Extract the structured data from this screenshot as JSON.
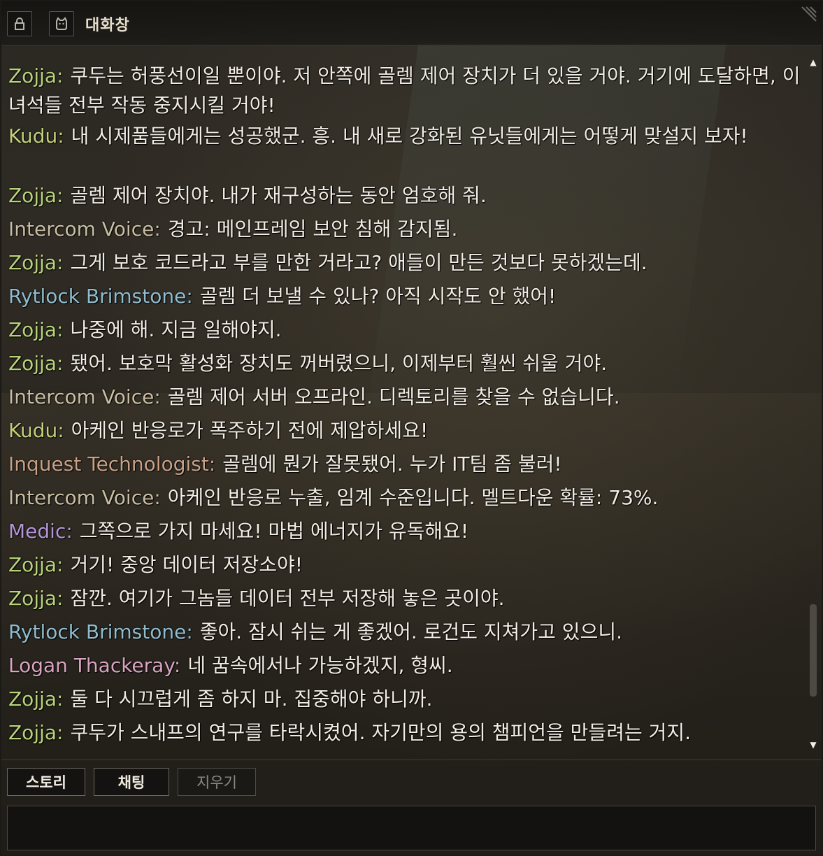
{
  "window": {
    "title": "대화창"
  },
  "colors": {
    "zojja": "#b8d27a",
    "kudu": "#c3cf7a",
    "intercom": "#c9bea4",
    "rytlock": "#8fbccf",
    "inquest": "#c9a188",
    "medic": "#b496d6",
    "logan": "#d9a4c0",
    "message": "#f2ede4"
  },
  "icons": {
    "lock": "lock-icon",
    "cat": "cat-icon",
    "grip": "resize-grip-icon",
    "scroll_up": "scroll-up-icon",
    "scroll_down": "scroll-down-icon"
  },
  "chat": {
    "messages": [
      {
        "speaker": "Zojja:",
        "text": "쿠두는 허풍선이일 뿐이야. 저 안쪽에 골렘 제어 장치가 더 있을 거야. 거기에 도달하면, 이 녀석들 전부 작동 중지시킬 거야!"
      },
      {
        "speaker": "Kudu:",
        "text": "내 시제품들에게는 성공했군. 흥. 내 새로 강화된 유닛들에게는 어떻게 맞설지 보자!"
      },
      {
        "speaker": "Zojja:",
        "text": "골렘 제어 장치야. 내가 재구성하는 동안 엄호해 줘."
      },
      {
        "speaker": "Intercom Voice:",
        "text": "경고: 메인프레임 보안 침해 감지됨."
      },
      {
        "speaker": "Zojja:",
        "text": "그게 보호 코드라고 부를 만한 거라고? 애들이 만든 것보다 못하겠는데."
      },
      {
        "speaker": "Rytlock Brimstone:",
        "text": "골렘 더 보낼 수 있나? 아직 시작도 안 했어!"
      },
      {
        "speaker": "Zojja:",
        "text": "나중에 해. 지금 일해야지."
      },
      {
        "speaker": "Zojja:",
        "text": "됐어. 보호막 활성화 장치도 꺼버렸으니, 이제부터 훨씬 쉬울 거야."
      },
      {
        "speaker": "Intercom Voice:",
        "text": "골렘 제어 서버 오프라인. 디렉토리를 찾을 수 없습니다."
      },
      {
        "speaker": "Kudu:",
        "text": "아케인 반응로가 폭주하기 전에 제압하세요!"
      },
      {
        "speaker": "Inquest Technologist:",
        "text": "골렘에 뭔가 잘못됐어. 누가 IT팀 좀 불러!"
      },
      {
        "speaker": "Intercom Voice:",
        "text": "아케인 반응로 누출, 임계 수준입니다. 멜트다운 확률: 73%."
      },
      {
        "speaker": "Medic:",
        "text": "그쪽으로 가지 마세요! 마법 에너지가 유독해요!"
      },
      {
        "speaker": "Zojja:",
        "text": "거기! 중앙 데이터 저장소야!"
      },
      {
        "speaker": "Zojja:",
        "text": "잠깐. 여기가 그놈들 데이터 전부 저장해 놓은 곳이야."
      },
      {
        "speaker": "Rytlock Brimstone:",
        "text": "좋아. 잠시 쉬는 게 좋겠어. 로건도 지쳐가고 있으니."
      },
      {
        "speaker": "Logan Thackeray:",
        "text": "네 꿈속에서나 가능하겠지, 형씨."
      },
      {
        "speaker": "Zojja:",
        "text": "둘 다 시끄럽게 좀 하지 마. 집중해야 하니까."
      },
      {
        "speaker": "Zojja:",
        "text": "쿠두가 스내프의 연구를 타락시켰어. 자기만의 용의 챔피언을 만들려는 거지."
      }
    ]
  },
  "tabs": {
    "story": "스토리",
    "chat": "채팅",
    "clear": "지우기"
  },
  "input": {
    "value": ""
  }
}
